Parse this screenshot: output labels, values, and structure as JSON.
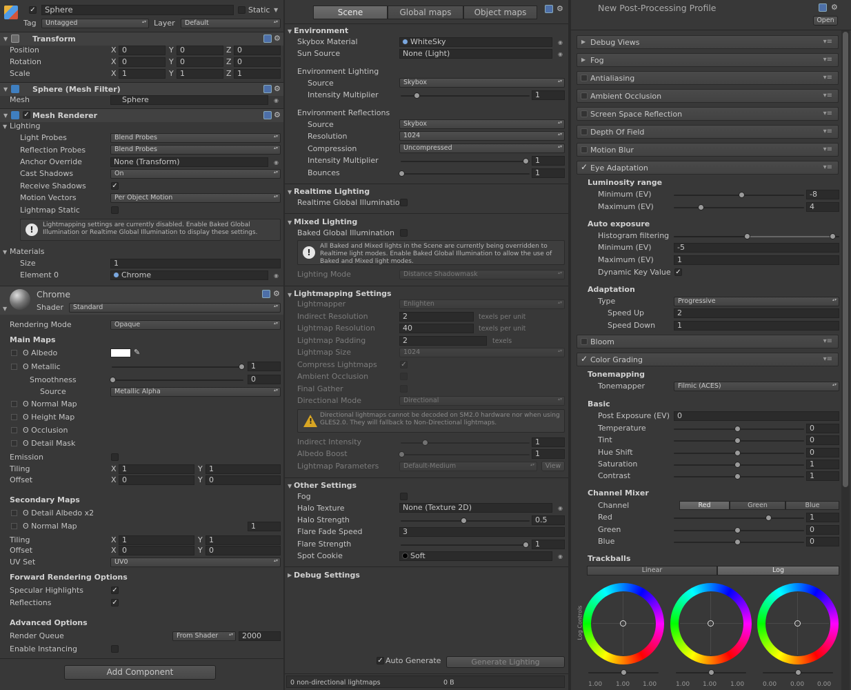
{
  "inspector": {
    "object_name": "Sphere",
    "static_label": "Static",
    "tag_label": "Tag",
    "tag_value": "Untagged",
    "layer_label": "Layer",
    "layer_value": "Default",
    "transform": {
      "title": "Transform",
      "position": "Position",
      "rotation": "Rotation",
      "scale": "Scale",
      "x": "X",
      "y": "Y",
      "z": "Z",
      "pos": [
        "0",
        "0",
        "0"
      ],
      "rot": [
        "0",
        "0",
        "0"
      ],
      "scl": [
        "1",
        "1",
        "1"
      ]
    },
    "mesh_filter": {
      "title": "Sphere (Mesh Filter)",
      "mesh_label": "Mesh",
      "mesh_value": "Sphere"
    },
    "mesh_renderer": {
      "title": "Mesh Renderer",
      "lighting": "Lighting",
      "light_probes": "Light Probes",
      "light_probes_value": "Blend Probes",
      "reflection_probes": "Reflection Probes",
      "reflection_probes_value": "Blend Probes",
      "anchor_override": "Anchor Override",
      "anchor_override_value": "None (Transform)",
      "cast_shadows": "Cast Shadows",
      "cast_shadows_value": "On",
      "receive_shadows": "Receive Shadows",
      "motion_vectors": "Motion Vectors",
      "motion_vectors_value": "Per Object Motion",
      "lightmap_static": "Lightmap Static",
      "help": "Lightmapping settings are currently disabled. Enable Baked Global Illumination or Realtime Global Illumination to display these settings.",
      "materials": "Materials",
      "size": "Size",
      "size_value": "1",
      "element0": "Element 0",
      "element0_value": "Chrome"
    },
    "material": {
      "name": "Chrome",
      "shader_label": "Shader",
      "shader_value": "Standard",
      "rendering_mode": "Rendering Mode",
      "rendering_mode_value": "Opaque",
      "main_maps": "Main Maps",
      "albedo": "Albedo",
      "metallic": "Metallic",
      "metallic_value": "1",
      "smoothness": "Smoothness",
      "smoothness_value": "0",
      "source": "Source",
      "source_value": "Metallic Alpha",
      "normal_map": "Normal Map",
      "height_map": "Height Map",
      "occlusion": "Occlusion",
      "detail_mask": "Detail Mask",
      "emission": "Emission",
      "tiling": "Tiling",
      "offset": "Offset",
      "x": "X",
      "y": "Y",
      "tiling_x": "1",
      "tiling_y": "1",
      "offset_x": "0",
      "offset_y": "0",
      "secondary_maps": "Secondary Maps",
      "detail_albedo": "Detail Albedo x2",
      "normal_map2": "Normal Map",
      "normal_map2_value": "1",
      "tiling2_x": "1",
      "tiling2_y": "1",
      "offset2_x": "0",
      "offset2_y": "0",
      "uv_set": "UV Set",
      "uv_set_value": "UV0",
      "forward_options": "Forward Rendering Options",
      "specular_highlights": "Specular Highlights",
      "reflections": "Reflections",
      "advanced_options": "Advanced Options",
      "render_queue": "Render Queue",
      "render_queue_mode": "From Shader",
      "render_queue_value": "2000",
      "enable_instancing": "Enable Instancing"
    },
    "add_component": "Add Component"
  },
  "lighting": {
    "tabs": [
      "Scene",
      "Global maps",
      "Object maps"
    ],
    "environment": "Environment",
    "skybox_material": "Skybox Material",
    "skybox_material_value": "WhiteSky",
    "sun_source": "Sun Source",
    "sun_source_value": "None (Light)",
    "env_lighting": "Environment Lighting",
    "source": "Source",
    "source_value": "Skybox",
    "intensity_multiplier": "Intensity Multiplier",
    "intensity_value": "1",
    "env_reflections": "Environment Reflections",
    "refl_source_value": "Skybox",
    "resolution": "Resolution",
    "resolution_value": "1024",
    "compression": "Compression",
    "compression_value": "Uncompressed",
    "refl_intensity_value": "1",
    "bounces": "Bounces",
    "bounces_value": "1",
    "realtime_lighting": "Realtime Lighting",
    "realtime_gi": "Realtime Global Illuminatio",
    "mixed_lighting": "Mixed Lighting",
    "baked_gi": "Baked Global Illumination",
    "mixed_help": "All Baked and Mixed lights in the Scene are currently being overridden to Realtime light modes. Enable Baked Global Illumination to allow the use of Baked and Mixed light modes.",
    "lighting_mode": "Lighting Mode",
    "lighting_mode_value": "Distance Shadowmask",
    "lightmapping_settings": "Lightmapping Settings",
    "lightmapper": "Lightmapper",
    "lightmapper_value": "Enlighten",
    "indirect_resolution": "Indirect Resolution",
    "indirect_resolution_value": "2",
    "texels_per_unit": "texels per unit",
    "lightmap_resolution": "Lightmap Resolution",
    "lightmap_resolution_value": "40",
    "lightmap_padding": "Lightmap Padding",
    "lightmap_padding_value": "2",
    "texels": "texels",
    "lightmap_size": "Lightmap Size",
    "lightmap_size_value": "1024",
    "compress_lightmaps": "Compress Lightmaps",
    "ambient_occlusion": "Ambient Occlusion",
    "final_gather": "Final Gather",
    "directional_mode": "Directional Mode",
    "directional_mode_value": "Directional",
    "dir_help": "Directional lightmaps cannot be decoded on SM2.0 hardware nor when using GLES2.0. They will fallback to Non-Directional lightmaps.",
    "indirect_intensity": "Indirect Intensity",
    "indirect_intensity_value": "1",
    "albedo_boost": "Albedo Boost",
    "albedo_boost_value": "1",
    "lightmap_parameters": "Lightmap Parameters",
    "lightmap_parameters_value": "Default-Medium",
    "view": "View",
    "other_settings": "Other Settings",
    "fog": "Fog",
    "halo_texture": "Halo Texture",
    "halo_texture_value": "None (Texture 2D)",
    "halo_strength": "Halo Strength",
    "halo_strength_value": "0.5",
    "flare_fade_speed": "Flare Fade Speed",
    "flare_fade_speed_value": "3",
    "flare_strength": "Flare Strength",
    "flare_strength_value": "1",
    "spot_cookie": "Spot Cookie",
    "spot_cookie_value": "Soft",
    "debug_settings": "Debug Settings",
    "auto_generate": "Auto Generate",
    "generate_lighting": "Generate Lighting",
    "status_left": "0 non-directional lightmaps",
    "status_right": "0 B"
  },
  "postprocessing": {
    "title": "New Post-Processing Profile",
    "open": "Open",
    "effects": [
      "Debug Views",
      "Fog",
      "Antialiasing",
      "Ambient Occlusion",
      "Screen Space Reflection",
      "Depth Of Field",
      "Motion Blur"
    ],
    "eye_adaptation": "Eye Adaptation",
    "luminosity_range": "Luminosity range",
    "minimum_ev": "Minimum (EV)",
    "maximum_ev": "Maximum (EV)",
    "lum_min": "-8",
    "lum_max": "4",
    "auto_exposure": "Auto exposure",
    "histogram_filtering": "Histogram filtering",
    "ae_min": "-5",
    "ae_max": "1",
    "dynamic_key": "Dynamic Key Value",
    "adaptation": "Adaptation",
    "type": "Type",
    "type_value": "Progressive",
    "speed_up": "Speed Up",
    "speed_up_value": "2",
    "speed_down": "Speed Down",
    "speed_down_value": "1",
    "bloom": "Bloom",
    "color_grading": "Color Grading",
    "tonemapping": "Tonemapping",
    "tonemapper": "Tonemapper",
    "tonemapper_value": "Filmic (ACES)",
    "basic": "Basic",
    "post_exposure": "Post Exposure (EV)",
    "post_exposure_value": "0",
    "temperature": "Temperature",
    "temperature_value": "0",
    "tint": "Tint",
    "tint_value": "0",
    "hue_shift": "Hue Shift",
    "hue_shift_value": "0",
    "saturation": "Saturation",
    "saturation_value": "1",
    "contrast": "Contrast",
    "contrast_value": "1",
    "channel_mixer": "Channel Mixer",
    "channel": "Channel",
    "channels": [
      "Red",
      "Green",
      "Blue"
    ],
    "red": "Red",
    "red_value": "1",
    "green": "Green",
    "green_value": "0",
    "blue": "Blue",
    "blue_value": "0",
    "trackballs": "Trackballs",
    "linear": "Linear",
    "log": "Log",
    "log_controls": "Log Controls",
    "trackball_values": [
      [
        "1.00",
        "1.00",
        "1.00"
      ],
      [
        "1.00",
        "1.00",
        "1.00"
      ],
      [
        "0.00",
        "0.00",
        "0.00"
      ]
    ]
  },
  "colors": {
    "panel": "#383838",
    "header": "#414141",
    "accent": "#5a5a5a",
    "warning": "#d9a623"
  }
}
